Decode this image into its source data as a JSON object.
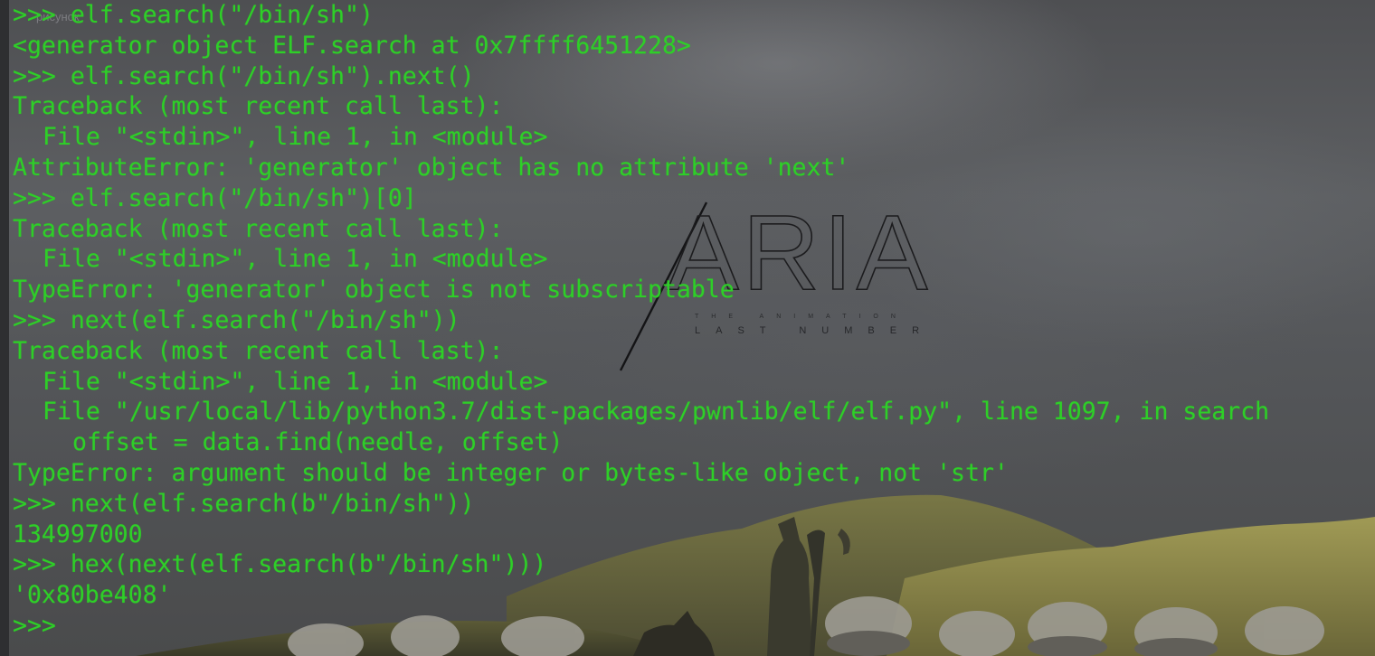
{
  "terminal": {
    "lines": [
      {
        "text": ">>> elf.search(\"/bin/sh\")",
        "indent": 0
      },
      {
        "text": "<generator object ELF.search at 0x7ffff6451228>",
        "indent": 0
      },
      {
        "text": ">>> elf.search(\"/bin/sh\").next()",
        "indent": 0
      },
      {
        "text": "Traceback (most recent call last):",
        "indent": 0
      },
      {
        "text": "File \"<stdin>\", line 1, in <module>",
        "indent": 1
      },
      {
        "text": "AttributeError: 'generator' object has no attribute 'next'",
        "indent": 0
      },
      {
        "text": ">>> elf.search(\"/bin/sh\")[0]",
        "indent": 0
      },
      {
        "text": "Traceback (most recent call last):",
        "indent": 0
      },
      {
        "text": "File \"<stdin>\", line 1, in <module>",
        "indent": 1
      },
      {
        "text": "TypeError: 'generator' object is not subscriptable",
        "indent": 0
      },
      {
        "text": ">>> next(elf.search(\"/bin/sh\"))",
        "indent": 0
      },
      {
        "text": "Traceback (most recent call last):",
        "indent": 0
      },
      {
        "text": "File \"<stdin>\", line 1, in <module>",
        "indent": 1
      },
      {
        "text": "File \"/usr/local/lib/python3.7/dist-packages/pwnlib/elf/elf.py\", line 1097, in search",
        "indent": 1
      },
      {
        "text": "offset = data.find(needle, offset)",
        "indent": 2
      },
      {
        "text": "TypeError: argument should be integer or bytes-like object, not 'str'",
        "indent": 0
      },
      {
        "text": ">>> next(elf.search(b\"/bin/sh\"))",
        "indent": 0
      },
      {
        "text": "134997000",
        "indent": 0
      },
      {
        "text": ">>> hex(next(elf.search(b\"/bin/sh\")))",
        "indent": 0
      },
      {
        "text": "'0x80be408'",
        "indent": 0
      },
      {
        "text": ">>> ",
        "indent": 0
      }
    ]
  },
  "wallpaper": {
    "logo_title": "ARIA",
    "logo_subtitle": "LAST NUMBER",
    "logo_tagline": "THE ANIMATION",
    "watermark": "рисунок"
  },
  "colors": {
    "terminal_text": "#2ecf28",
    "background": "#4e4f52",
    "hills": "#8c8a45"
  }
}
